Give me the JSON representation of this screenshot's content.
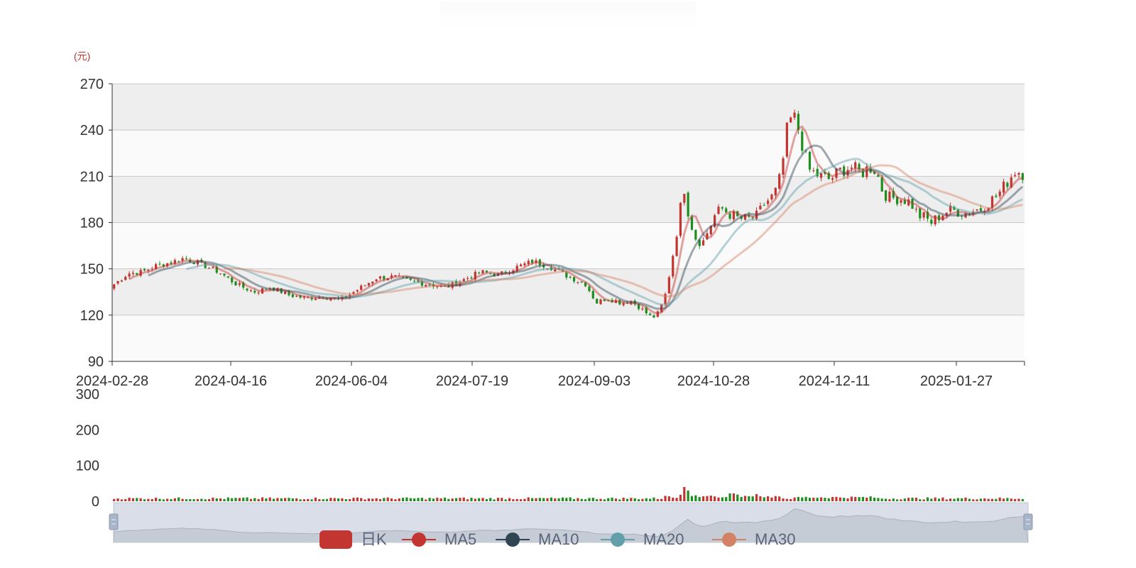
{
  "chart_data": {
    "type": "candlestick",
    "unit_label": "(元)",
    "price_axis": {
      "ticks": [
        "270",
        "240",
        "210",
        "180",
        "150",
        "120",
        "90"
      ],
      "ylim": [
        90,
        270
      ]
    },
    "volume_axis": {
      "ticks": [
        "300",
        "200",
        "100",
        "0"
      ],
      "ylim": [
        0,
        300
      ]
    },
    "x_ticks": [
      "2024-02-28",
      "2024-04-16",
      "2024-06-04",
      "2024-07-19",
      "2024-09-03",
      "2024-10-28",
      "2024-12-11",
      "2025-01-27"
    ],
    "start_date": "2024-02-28",
    "trading_days": 240,
    "anchors": [
      [
        0,
        140
      ],
      [
        4,
        147
      ],
      [
        8,
        148
      ],
      [
        12,
        152
      ],
      [
        16,
        154
      ],
      [
        20,
        157
      ],
      [
        25,
        153
      ],
      [
        30,
        148
      ],
      [
        35,
        140
      ],
      [
        40,
        135
      ],
      [
        45,
        138
      ],
      [
        50,
        133
      ],
      [
        55,
        131
      ],
      [
        60,
        132
      ],
      [
        65,
        130
      ],
      [
        70,
        137
      ],
      [
        75,
        144
      ],
      [
        80,
        145
      ],
      [
        85,
        142
      ],
      [
        90,
        140
      ],
      [
        95,
        138
      ],
      [
        100,
        143
      ],
      [
        105,
        148
      ],
      [
        110,
        146
      ],
      [
        115,
        151
      ],
      [
        120,
        155
      ],
      [
        125,
        151
      ],
      [
        130,
        145
      ],
      [
        135,
        140
      ],
      [
        138,
        128
      ],
      [
        141,
        131
      ],
      [
        145,
        128
      ],
      [
        148,
        129
      ],
      [
        151,
        124
      ],
      [
        154,
        118
      ],
      [
        156,
        122
      ],
      [
        158,
        135
      ],
      [
        160,
        160
      ],
      [
        162,
        188
      ],
      [
        163,
        205
      ],
      [
        164,
        190
      ],
      [
        166,
        172
      ],
      [
        168,
        165
      ],
      [
        170,
        175
      ],
      [
        172,
        185
      ],
      [
        174,
        189
      ],
      [
        176,
        186
      ],
      [
        178,
        183
      ],
      [
        181,
        182
      ],
      [
        184,
        184
      ],
      [
        186,
        192
      ],
      [
        189,
        198
      ],
      [
        191,
        212
      ],
      [
        192,
        232
      ],
      [
        193,
        246
      ],
      [
        195,
        248
      ],
      [
        197,
        230
      ],
      [
        199,
        214
      ],
      [
        202,
        210
      ],
      [
        205,
        208
      ],
      [
        208,
        214
      ],
      [
        211,
        216
      ],
      [
        214,
        212
      ],
      [
        216,
        216
      ],
      [
        218,
        214
      ],
      [
        220,
        200
      ],
      [
        222,
        196
      ],
      [
        224,
        196
      ],
      [
        226,
        195
      ],
      [
        228,
        193
      ],
      [
        230,
        185
      ],
      [
        232,
        183
      ],
      [
        234,
        180
      ],
      [
        236,
        184
      ],
      [
        238,
        187
      ],
      [
        240,
        188
      ],
      [
        242,
        187
      ],
      [
        244,
        186
      ],
      [
        246,
        188
      ],
      [
        248,
        189
      ],
      [
        250,
        193
      ],
      [
        252,
        196
      ],
      [
        254,
        201
      ],
      [
        256,
        208
      ],
      [
        258,
        214
      ],
      [
        260,
        212
      ]
    ],
    "volume_notes": "daily volume bars mostly 5-12, spike to ~40 near 2024-09-30",
    "series": [
      {
        "name": "日K",
        "color": "#c23531"
      },
      {
        "name": "MA5",
        "color": "#c23531",
        "period": 5
      },
      {
        "name": "MA10",
        "color": "#2f4554",
        "period": 10
      },
      {
        "name": "MA20",
        "color": "#61a0a8",
        "period": 20
      },
      {
        "name": "MA30",
        "color": "#d48265",
        "period": 30
      }
    ],
    "up_color": "#c23531",
    "down_color": "#1e8e1e"
  },
  "legend": {
    "items": [
      {
        "label": "日K",
        "color": "#c23531",
        "icon": "candle-swatch-icon"
      },
      {
        "label": "MA5",
        "color": "#c23531",
        "icon": "circle-line-icon"
      },
      {
        "label": "MA10",
        "color": "#2f4554",
        "icon": "circle-line-icon"
      },
      {
        "label": "MA20",
        "color": "#61a0a8",
        "icon": "circle-line-icon"
      },
      {
        "label": "MA30",
        "color": "#d48265",
        "icon": "circle-line-icon"
      }
    ]
  }
}
